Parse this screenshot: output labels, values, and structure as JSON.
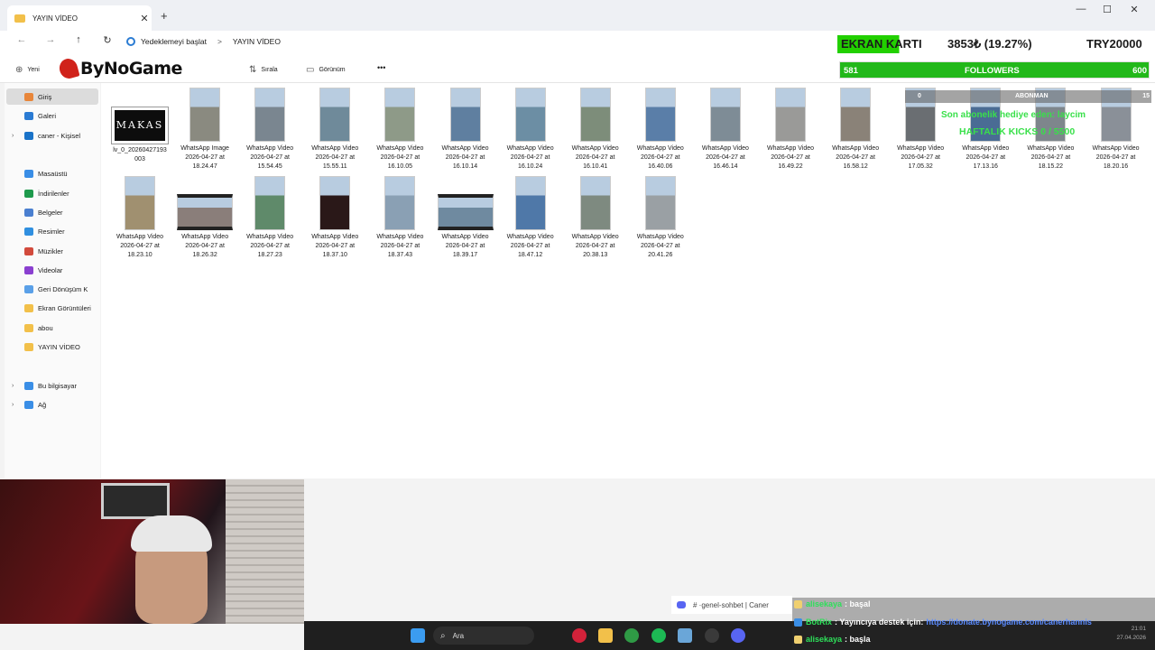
{
  "window": {
    "tab_title": "YAYIN VİDEO",
    "new_tab": "+",
    "minimize": "—",
    "maximize": "☐",
    "close": "✕"
  },
  "address": {
    "back": "←",
    "forward": "→",
    "up": "↑",
    "refresh": "↻",
    "crumbs": [
      "Yedeklemeyi başlat",
      "YAYIN VİDEO"
    ],
    "crumb_sep": ">"
  },
  "toolbar": {
    "new_label": "Yeni",
    "sort_label": "Sırala",
    "view_label": "Görünüm",
    "more": "•••",
    "logo_text": "ByNoGame"
  },
  "sidebar": {
    "items": [
      {
        "label": "Giriş",
        "icon": "home-icon",
        "color": "#e8863a"
      },
      {
        "label": "Galeri",
        "icon": "gallery-icon",
        "color": "#2a7bd3"
      },
      {
        "label": "caner - Kişisel",
        "icon": "cloud-icon",
        "color": "#1a73c8"
      },
      {
        "label": "Masaüstü",
        "icon": "desktop-icon",
        "color": "#3a8ee6"
      },
      {
        "label": "İndirilenler",
        "icon": "download-icon",
        "color": "#1e9a4c"
      },
      {
        "label": "Belgeler",
        "icon": "documents-icon",
        "color": "#4a7fd0"
      },
      {
        "label": "Resimler",
        "icon": "pictures-icon",
        "color": "#2f8fe0"
      },
      {
        "label": "Müzikler",
        "icon": "music-icon",
        "color": "#d24a3c"
      },
      {
        "label": "Videolar",
        "icon": "videos-icon",
        "color": "#8a3fd0"
      },
      {
        "label": "Geri Dönüşüm K",
        "icon": "recycle-bin-icon",
        "color": "#5aa0e8"
      },
      {
        "label": "Ekran Görüntüleri",
        "icon": "folder-icon",
        "color": "#f2c04a"
      },
      {
        "label": "abou",
        "icon": "folder-icon",
        "color": "#f2c04a"
      },
      {
        "label": "YAYIN VİDEO",
        "icon": "folder-icon",
        "color": "#f2c04a"
      },
      {
        "label": "Bu bilgisayar",
        "icon": "pc-icon",
        "color": "#3a8ee6"
      },
      {
        "label": "Ağ",
        "icon": "network-icon",
        "color": "#3a8ee6"
      }
    ]
  },
  "files": [
    {
      "name": "lv_0_20260427193",
      "date": "003",
      "thumb": "makas",
      "thumb_text": "MAKAS"
    },
    {
      "name": "WhatsApp Image",
      "date": "2026-04-27 at",
      "time": "18.24.47",
      "thumb": "portrait",
      "color": "#8a8a80"
    },
    {
      "name": "WhatsApp Video",
      "date": "2026-04-27 at",
      "time": "15.54.45",
      "thumb": "portrait",
      "color": "#7a8690"
    },
    {
      "name": "WhatsApp Video",
      "date": "2026-04-27 at",
      "time": "15.55.11",
      "thumb": "portrait",
      "color": "#6f8a9a"
    },
    {
      "name": "WhatsApp Video",
      "date": "2026-04-27 at",
      "time": "16.10.05",
      "thumb": "portrait",
      "color": "#8e9a88"
    },
    {
      "name": "WhatsApp Video",
      "date": "2026-04-27 at",
      "time": "16.10.14",
      "thumb": "portrait",
      "color": "#5f7fa0"
    },
    {
      "name": "WhatsApp Video",
      "date": "2026-04-27 at",
      "time": "16.10.24",
      "thumb": "portrait",
      "color": "#6c8ea4"
    },
    {
      "name": "WhatsApp Video",
      "date": "2026-04-27 at",
      "time": "16.10.41",
      "thumb": "portrait",
      "color": "#7d8d7a"
    },
    {
      "name": "WhatsApp Video",
      "date": "2026-04-27 at",
      "time": "16.40.06",
      "thumb": "portrait",
      "color": "#5a7ea8"
    },
    {
      "name": "WhatsApp Video",
      "date": "2026-04-27 at",
      "time": "16.46.14",
      "thumb": "portrait",
      "color": "#7e8c96"
    },
    {
      "name": "WhatsApp Video",
      "date": "2026-04-27 at",
      "time": "16.49.22",
      "thumb": "portrait",
      "color": "#9a9a98"
    },
    {
      "name": "WhatsApp Video",
      "date": "2026-04-27 at",
      "time": "16.58.12",
      "thumb": "portrait",
      "color": "#8a8278"
    },
    {
      "name": "WhatsApp Video",
      "date": "2026-04-27 at",
      "time": "17.05.32",
      "thumb": "portrait",
      "color": "#6a6e72"
    },
    {
      "name": "WhatsApp Video",
      "date": "2026-04-27 at",
      "time": "17.13.16",
      "thumb": "portrait",
      "color": "#4a6c94"
    },
    {
      "name": "WhatsApp Video",
      "date": "2026-04-27 at",
      "time": "18.15.22",
      "thumb": "portrait",
      "color": "#7e868c"
    },
    {
      "name": "WhatsApp Video",
      "date": "2026-04-27 at",
      "time": "18.20.16",
      "thumb": "portrait",
      "color": "#8a9098"
    },
    {
      "name": "WhatsApp Video",
      "date": "2026-04-27 at",
      "time": "18.23.10",
      "thumb": "portrait",
      "color": "#a09070"
    },
    {
      "name": "WhatsApp Video",
      "date": "2026-04-27 at",
      "time": "18.26.32",
      "thumb": "land",
      "color": "#8a7e7a"
    },
    {
      "name": "WhatsApp Video",
      "date": "2026-04-27 at",
      "time": "18.27.23",
      "thumb": "portrait",
      "color": "#5f8a6a"
    },
    {
      "name": "WhatsApp Video",
      "date": "2026-04-27 at",
      "time": "18.37.10",
      "thumb": "portrait",
      "color": "#2a1818"
    },
    {
      "name": "WhatsApp Video",
      "date": "2026-04-27 at",
      "time": "18.37.43",
      "thumb": "portrait",
      "color": "#8aa0b4"
    },
    {
      "name": "WhatsApp Video",
      "date": "2026-04-27 at",
      "time": "18.39.17",
      "thumb": "land",
      "color": "#6f8aa0"
    },
    {
      "name": "WhatsApp Video",
      "date": "2026-04-27 at",
      "time": "18.47.12",
      "thumb": "portrait",
      "color": "#4f78a8"
    },
    {
      "name": "WhatsApp Video",
      "date": "2026-04-27 at",
      "time": "20.38.13",
      "thumb": "portrait",
      "color": "#7e8a80"
    },
    {
      "name": "WhatsApp Video",
      "date": "2026-04-27 at",
      "time": "20.41.26",
      "thumb": "portrait",
      "color": "#9aa0a4"
    }
  ],
  "overlay": {
    "ekran_label": "EKRAN KARTI",
    "ekran_progress": "3853₺ (19.27%)",
    "ekran_target": "TRY20000",
    "followers_current": "581",
    "followers_label": "FOLLOWERS",
    "followers_goal": "600",
    "abonman_current": "0",
    "abonman_label": "ABONMAN",
    "abonman_goal": "15",
    "sub_gift_line": "Son abonelik hediye eden: laycim",
    "kicks_line": "HAFTALIK KICKS 0 / 5500"
  },
  "taskbar": {
    "search_label": "Ara",
    "time": "21:01",
    "date": "27.04.2026"
  },
  "notification": {
    "text": "# ·genel-sohbet | Caner"
  },
  "chat": [
    {
      "user": "alisekaya",
      "msg": ": başal"
    },
    {
      "user": "BotRix",
      "msg": ": Yayıncıya destek için:",
      "link": "https://donate.bynogame.com/canerhannis"
    },
    {
      "user": "alisekaya",
      "msg": ": başla"
    }
  ],
  "colors": {
    "followers_bar": "#22b81a",
    "ekran_fill": "#22d000",
    "chat_user": "#2ee05a",
    "discord": "#5865f2"
  }
}
